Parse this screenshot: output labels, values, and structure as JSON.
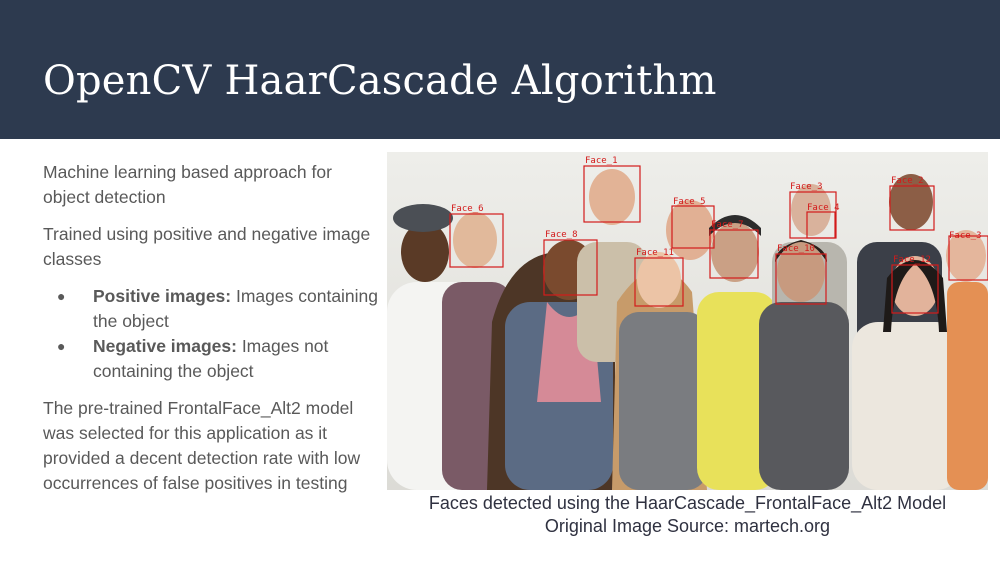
{
  "slide": {
    "title": "OpenCV HaarCascade Algorithm",
    "intro": "Machine learning based approach for object detection",
    "trained": "Trained using positive and negative image classes",
    "bullets": [
      {
        "bold": "Positive images:",
        "text": " Images containing the object"
      },
      {
        "bold": "Negative images:",
        "text": " Images not containing the object"
      }
    ],
    "conclusion": "The pre-trained FrontalFace_Alt2 model was selected for this application as it provided a decent detection rate with low occurrences of false positives in testing"
  },
  "figure": {
    "caption_line1": "Faces detected using the HaarCascade_FrontalFace_Alt2 Model",
    "caption_line2": "Original Image Source: martech.org",
    "face_labels": [
      "Face_1",
      "Face_2",
      "Face_3",
      "Face_4",
      "Face_5",
      "Face_6",
      "Face_7",
      "Face_8",
      "Face_9",
      "Face_10",
      "Face_11",
      "Face_12"
    ]
  },
  "colors": {
    "header": "#2d3a4f",
    "box": "#d31b1b",
    "body_text": "#595959"
  }
}
